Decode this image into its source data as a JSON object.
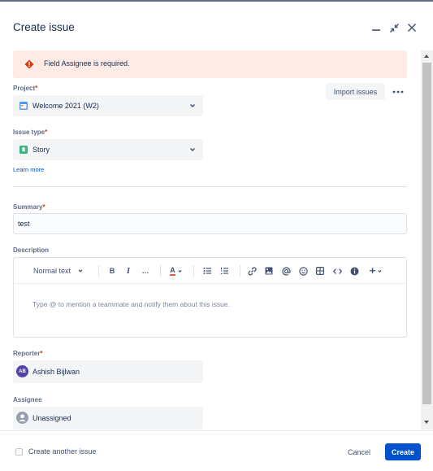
{
  "dialog": {
    "title": "Create issue",
    "minimize_icon": "minimize-icon",
    "collapse_icon": "collapse-arrows-icon",
    "close_icon": "close-icon"
  },
  "error": {
    "message": "Field Assignee is required.",
    "icon": "error-diamond-icon",
    "color": "#ffebe6"
  },
  "import_label": "Import issues",
  "project": {
    "label": "Project",
    "required_mark": "*",
    "value": "Welcome 2021 (W2)",
    "icon": "project-calendar-icon"
  },
  "issue_type": {
    "label": "Issue type",
    "required_mark": "*",
    "value": "Story",
    "icon": "story-bookmark-icon",
    "learn_more": "Learn more"
  },
  "summary": {
    "label": "Summary",
    "required_mark": "*",
    "value": "test"
  },
  "description": {
    "label": "Description",
    "text_style": "Normal text",
    "placeholder": "Type @ to mention a teammate and notify them about this issue.",
    "toolbar": {
      "bold": "B",
      "italic": "I",
      "more": "…",
      "text_color": "A",
      "insert": "+"
    }
  },
  "reporter": {
    "label": "Reporter",
    "required_mark": "*",
    "initials": "AB",
    "name": "Ashish Bijlwan"
  },
  "assignee": {
    "label": "Assignee",
    "value": "Unassigned"
  },
  "footer": {
    "create_another": "Create another issue",
    "cancel": "Cancel",
    "create": "Create"
  },
  "colors": {
    "primary": "#0052cc",
    "required": "#de350b",
    "avatar": "#5243aa"
  }
}
